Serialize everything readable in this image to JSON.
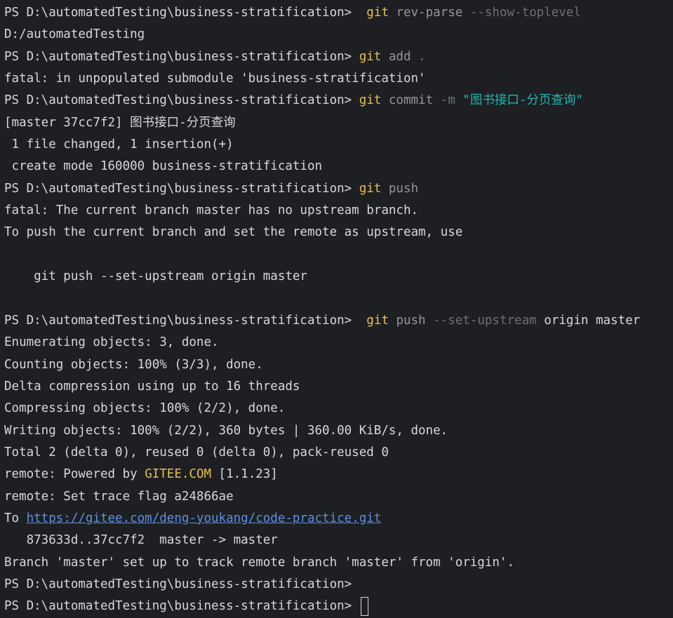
{
  "colors": {
    "background": "#1e1f22",
    "text": "#d5d8de",
    "git_keyword": "#e5c04a",
    "command_arg": "#93969c",
    "flag": "#6d7077",
    "string": "#1fb7b3",
    "link": "#5f8fe8"
  },
  "terminal": {
    "prompt": "PS D:\\automatedTesting\\business-stratification> ",
    "l1": {
      "git": "git",
      "cmd": "rev-parse",
      "flag": "--show-toplevel"
    },
    "l2": "D:/automatedTesting",
    "l3": {
      "git": "git",
      "cmd": "add",
      "flag": "."
    },
    "l4": "fatal: in unpopulated submodule 'business-stratification'",
    "l5": {
      "git": "git",
      "cmd": "commit",
      "flag": "-m",
      "str": "\"图书接口-分页查询\""
    },
    "l6": "[master 37cc7f2] 图书接口-分页查询",
    "l7": " 1 file changed, 1 insertion(+)",
    "l8": " create mode 160000 business-stratification",
    "l9": {
      "git": "git",
      "cmd": "push"
    },
    "l10": "fatal: The current branch master has no upstream branch.",
    "l11": "To push the current branch and set the remote as upstream, use",
    "l13": "    git push --set-upstream origin master",
    "l15": {
      "git": "git",
      "cmd": "push",
      "flag": "--set-upstream",
      "rest": "origin master"
    },
    "l16": "Enumerating objects: 3, done.",
    "l17": "Counting objects: 100% (3/3), done.",
    "l18": "Delta compression using up to 16 threads",
    "l19": "Compressing objects: 100% (2/2), done.",
    "l20": "Writing objects: 100% (2/2), 360 bytes | 360.00 KiB/s, done.",
    "l21": "Total 2 (delta 0), reused 0 (delta 0), pack-reused 0",
    "l22": {
      "pre": "remote: Powered by ",
      "gitee": "GITEE.COM",
      "post": " [1.1.23]"
    },
    "l23": "remote: Set trace flag a24866ae",
    "l24": {
      "pre": "To ",
      "url": "https://gitee.com/deng-youkang/code-practice.git"
    },
    "l25": "   873633d..37cc7f2  master -> master",
    "l26": "Branch 'master' set up to track remote branch 'master' from 'origin'."
  }
}
